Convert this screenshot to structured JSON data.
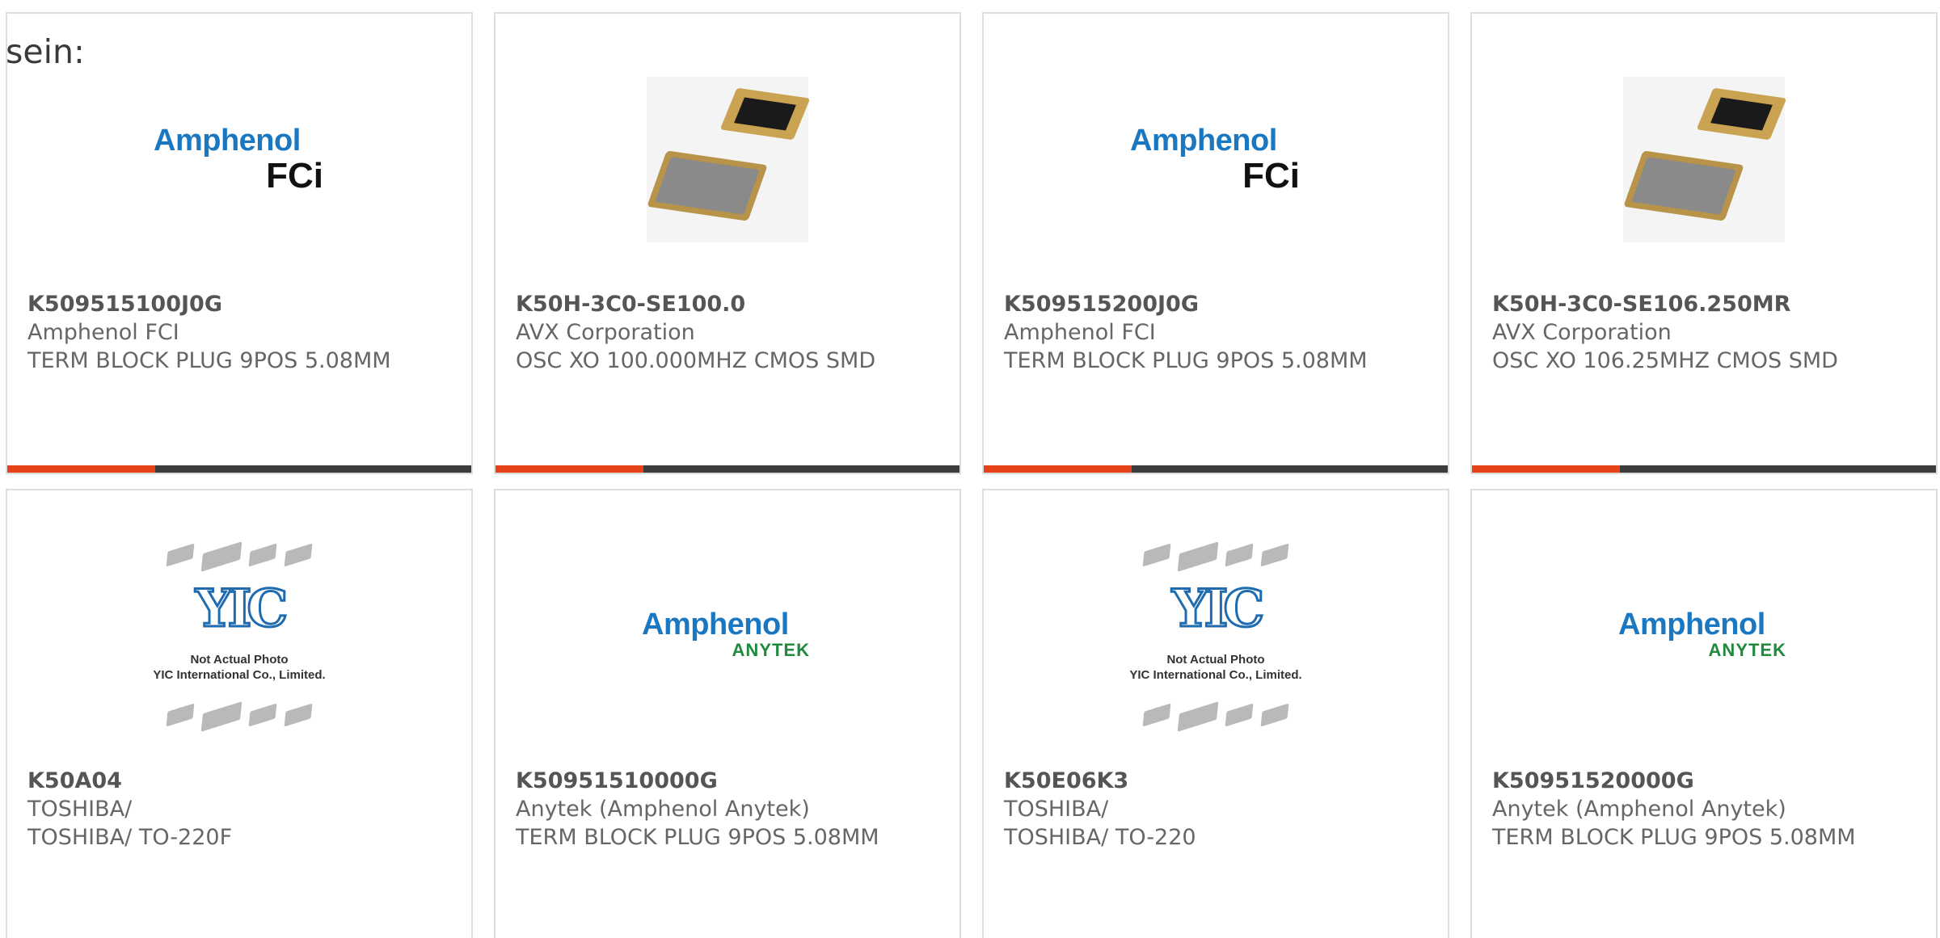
{
  "page": {
    "prefix_text": "sein:"
  },
  "products": [
    {
      "part_number": "K509515100J0G",
      "manufacturer": "Amphenol FCI",
      "description": "TERM BLOCK PLUG 9POS 5.08MM",
      "image": "amphenol-fci-logo",
      "logo": {
        "line1": "Amphenol",
        "line2": "FCi"
      }
    },
    {
      "part_number": "K50H-3C0-SE100.0",
      "manufacturer": "AVX Corporation",
      "description": "OSC XO 100.000MHZ CMOS SMD",
      "image": "oscillator-photo"
    },
    {
      "part_number": "K509515200J0G",
      "manufacturer": "Amphenol FCI",
      "description": "TERM BLOCK PLUG 9POS 5.08MM",
      "image": "amphenol-fci-logo",
      "logo": {
        "line1": "Amphenol",
        "line2": "FCi"
      }
    },
    {
      "part_number": "K50H-3C0-SE106.250MR",
      "manufacturer": "AVX Corporation",
      "description": "OSC XO 106.25MHZ CMOS SMD",
      "image": "oscillator-photo"
    },
    {
      "part_number": "K50A04",
      "manufacturer": "TOSHIBA/",
      "description": "TOSHIBA/ TO-220F",
      "image": "yic-placeholder",
      "logo": {
        "mark": "YIC",
        "caption1": "Not Actual Photo",
        "caption2": "YIC International Co., Limited."
      }
    },
    {
      "part_number": "K50951510000G",
      "manufacturer": "Anytek (Amphenol Anytek)",
      "description": "TERM BLOCK PLUG 9POS 5.08MM",
      "image": "amphenol-anytek-logo",
      "logo": {
        "line1": "Amphenol",
        "line2": "ANYTEK"
      }
    },
    {
      "part_number": "K50E06K3",
      "manufacturer": "TOSHIBA/",
      "description": "TOSHIBA/ TO-220",
      "image": "yic-placeholder",
      "logo": {
        "mark": "YIC",
        "caption1": "Not Actual Photo",
        "caption2": "YIC International Co., Limited."
      }
    },
    {
      "part_number": "K50951520000G",
      "manufacturer": "Anytek (Amphenol Anytek)",
      "description": "TERM BLOCK PLUG 9POS 5.08MM",
      "image": "amphenol-anytek-logo",
      "logo": {
        "line1": "Amphenol",
        "line2": "ANYTEK"
      }
    }
  ],
  "colors": {
    "accent": "#e8421b",
    "bar": "#3c3c3c",
    "border": "#dedede",
    "amphenol_blue": "#1a78c2",
    "anytek_green": "#1f8a3c"
  }
}
